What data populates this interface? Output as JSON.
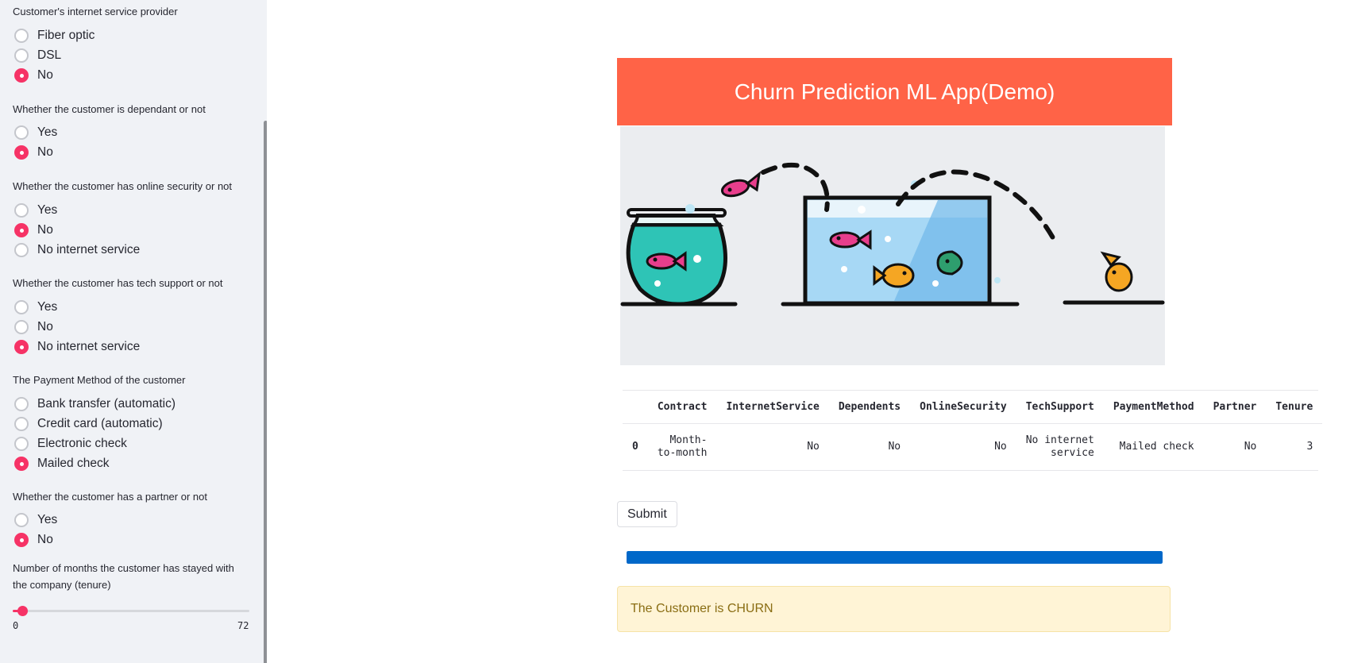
{
  "sidebar": {
    "internet_service": {
      "label": "Customer's internet service provider",
      "options": [
        "Fiber optic",
        "DSL",
        "No"
      ],
      "selected": "No"
    },
    "dependents": {
      "label": "Whether the customer is dependant or not",
      "options": [
        "Yes",
        "No"
      ],
      "selected": "No"
    },
    "online_security": {
      "label": "Whether the customer has online security or not",
      "options": [
        "Yes",
        "No",
        "No internet service"
      ],
      "selected": "No"
    },
    "tech_support": {
      "label": "Whether the customer has tech support or not",
      "options": [
        "Yes",
        "No",
        "No internet service"
      ],
      "selected": "No internet service"
    },
    "payment_method": {
      "label": "The Payment Method of the customer",
      "options": [
        "Bank transfer (automatic)",
        "Credit card (automatic)",
        "Electronic check",
        "Mailed check"
      ],
      "selected": "Mailed check"
    },
    "partner": {
      "label": "Whether the customer has a partner or not",
      "options": [
        "Yes",
        "No"
      ],
      "selected": "No"
    },
    "tenure": {
      "label": "Number of months the customer has stayed with the company (tenure)",
      "min": "0",
      "max": "72",
      "value": 3
    }
  },
  "main": {
    "title": "Churn Prediction ML App(Demo)",
    "banner_color": "#ff6347",
    "table": {
      "columns": [
        "",
        "Contract",
        "InternetService",
        "Dependents",
        "OnlineSecurity",
        "TechSupport",
        "PaymentMethod",
        "Partner",
        "Tenure"
      ],
      "rows": [
        [
          "0",
          "Month-to-month",
          "No",
          "No",
          "No",
          "No internet service",
          "Mailed check",
          "No",
          "3"
        ]
      ]
    },
    "submit_label": "Submit",
    "progress": 1.0,
    "progress_color": "#0068c9",
    "result_text": "The Customer is CHURN"
  },
  "colors": {
    "accent": "#f63366",
    "sidebar_bg": "#f0f2f6",
    "alert_bg": "#fff4d6",
    "alert_text": "#8a6d13"
  }
}
